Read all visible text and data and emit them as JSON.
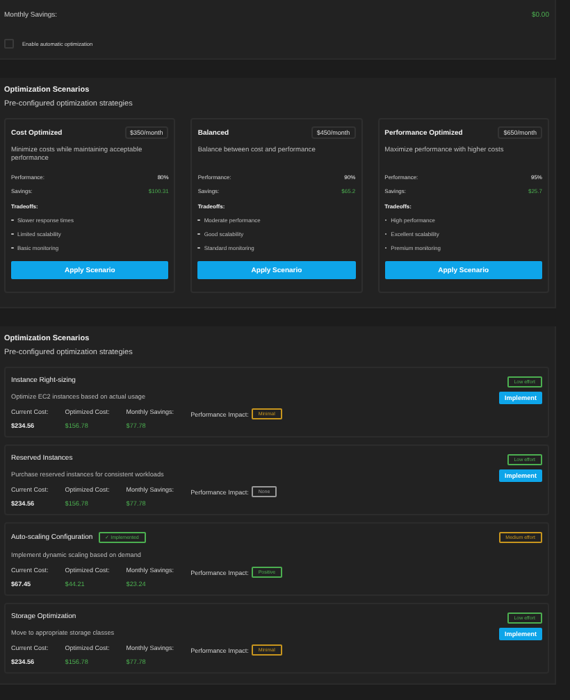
{
  "summary": {
    "savings_label": "Monthly Savings:",
    "savings_value": "$0.00",
    "auto_optimization": {
      "label": "Enable automatic optimization",
      "checked": false
    }
  },
  "scenarios": {
    "title": "Optimization Scenarios",
    "subtitle": "Pre-configured optimization strategies",
    "cards": [
      {
        "name": "Cost Optimized",
        "price": "$350/month",
        "description": "Minimize costs while maintaining acceptable performance",
        "performance_label": "Performance:",
        "performance": "80%",
        "savings_label": "Savings:",
        "savings": "$100.31",
        "tradeoffs_label": "Tradeoffs:",
        "tradeoffs": [
          "Slower response times",
          "Limited scalability",
          "Basic monitoring"
        ],
        "action": "Apply Scenario"
      },
      {
        "name": "Balanced",
        "price": "$450/month",
        "description": "Balance between cost and performance",
        "performance_label": "Performance:",
        "performance": "90%",
        "savings_label": "Savings:",
        "savings": "$65.2",
        "tradeoffs_label": "Tradeoffs:",
        "tradeoffs": [
          "Moderate performance",
          "Good scalability",
          "Standard monitoring"
        ],
        "action": "Apply Scenario"
      },
      {
        "name": "Performance Optimized",
        "price": "$650/month",
        "description": "Maximize performance with higher costs",
        "performance_label": "Performance:",
        "performance": "95%",
        "savings_label": "Savings:",
        "savings": "$25.7",
        "tradeoffs_label": "Tradeoffs:",
        "tradeoffs": [
          "High performance",
          "Excellent scalability",
          "Premium monitoring"
        ],
        "action": "Apply Scenario"
      }
    ]
  },
  "recommendations": {
    "title": "Optimization Scenarios",
    "subtitle": "Pre-configured optimization strategies",
    "items": [
      {
        "title": "Instance Right-sizing",
        "description": "Optimize EC2 instances based on actual usage",
        "implemented": false,
        "action": "Implement",
        "effort": {
          "label": "Low effort",
          "color": "#4caf50"
        },
        "metrics": [
          {
            "label": "Current Cost:",
            "value": "$234.56"
          },
          {
            "label": "Optimized Cost:",
            "value": "$156.78"
          },
          {
            "label": "Monthly Savings:",
            "value": "$77.78"
          }
        ],
        "impact": {
          "label": "Performance Impact:",
          "value": "Minimal",
          "color": "#c8961e"
        }
      },
      {
        "title": "Reserved Instances",
        "description": "Purchase reserved instances for consistent workloads",
        "implemented": false,
        "action": "Implement",
        "effort": {
          "label": "Low effort",
          "color": "#4caf50"
        },
        "metrics": [
          {
            "label": "Current Cost:",
            "value": "$234.56"
          },
          {
            "label": "Optimized Cost:",
            "value": "$156.78"
          },
          {
            "label": "Monthly Savings:",
            "value": "$77.78"
          }
        ],
        "impact": {
          "label": "Performance Impact:",
          "value": "None",
          "color": "#9a9a9a"
        }
      },
      {
        "title": "Auto-scaling Configuration",
        "description": "Implement dynamic scaling based on demand",
        "implemented": true,
        "status": "✓ Implemented",
        "effort": {
          "label": "Medium effort",
          "color": "#c8961e"
        },
        "metrics": [
          {
            "label": "Current Cost:",
            "value": "$67.45"
          },
          {
            "label": "Optimized Cost:",
            "value": "$44.21"
          },
          {
            "label": "Monthly Savings:",
            "value": "$23.24"
          }
        ],
        "impact": {
          "label": "Performance Impact:",
          "value": "Positive",
          "color": "#4caf50"
        }
      },
      {
        "title": "Storage Optimization",
        "description": "Move to appropriate storage classes",
        "implemented": false,
        "action": "Implement",
        "effort": {
          "label": "Low effort",
          "color": "#4caf50"
        },
        "metrics": [
          {
            "label": "Current Cost:",
            "value": "$234.56"
          },
          {
            "label": "Optimized Cost:",
            "value": "$156.78"
          },
          {
            "label": "Monthly Savings:",
            "value": "$77.78"
          }
        ],
        "impact": {
          "label": "Performance Impact:",
          "value": "Minimal",
          "color": "#c8961e"
        }
      }
    ]
  }
}
